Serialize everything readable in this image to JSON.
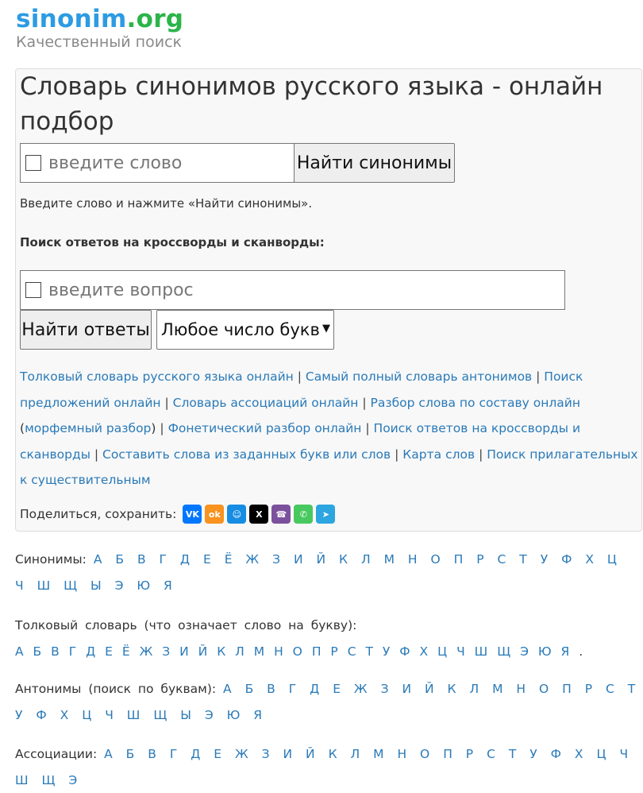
{
  "logo": {
    "name_part1": "sinonim",
    "name_part2": ".org",
    "tagline": "Качественный поиск"
  },
  "main": {
    "title": "Словарь синонимов русского языка - онлайн подбор",
    "word_search": {
      "placeholder": "введите слово",
      "button": "Найти синонимы"
    },
    "hint": "Введите слово и нажмите «Найти синонимы».",
    "crossword_title": "Поиск ответов на кроссворды и сканворды:",
    "question_search": {
      "placeholder": "введите вопрос",
      "button": "Найти ответы",
      "letters_select": "Любое число букв"
    },
    "links": [
      "Толковый словарь русского языка онлайн",
      "Самый полный словарь антонимов",
      "Поиск предложений онлайн",
      "Словарь ассоциаций онлайн",
      "Разбор слова по составу онлайн",
      "морфемный разбор",
      "Фонетический разбор онлайн",
      "Поиск ответов на кроссворды и сканворды",
      "Составить слова из заданных букв или слов",
      "Карта слов",
      "Поиск прилагательных к существительным"
    ],
    "share_label": "Поделиться, сохранить:",
    "share_icons": [
      "vk-icon",
      "odnoklassniki-icon",
      "moimir-icon",
      "x-icon",
      "viber-icon",
      "whatsapp-icon",
      "telegram-icon"
    ]
  },
  "alphabets": {
    "synonyms": {
      "label": "Синонимы:",
      "letters": [
        "А",
        "Б",
        "В",
        "Г",
        "Д",
        "Е",
        "Ё",
        "Ж",
        "З",
        "И",
        "Й",
        "К",
        "Л",
        "М",
        "Н",
        "О",
        "П",
        "Р",
        "С",
        "Т",
        "У",
        "Ф",
        "Х",
        "Ц",
        "Ч",
        "Ш",
        "Щ",
        "Ы",
        "Э",
        "Ю",
        "Я"
      ]
    },
    "explanatory": {
      "label": "Толковый словарь (что означает слово на букву):",
      "letters": [
        "А",
        "Б",
        "В",
        "Г",
        "Д",
        "Е",
        "Ё",
        "Ж",
        "З",
        "И",
        "Й",
        "К",
        "Л",
        "М",
        "Н",
        "О",
        "П",
        "Р",
        "С",
        "Т",
        "У",
        "Ф",
        "Х",
        "Ц",
        "Ч",
        "Ш",
        "Щ",
        "Э",
        "Ю",
        "Я"
      ]
    },
    "antonyms": {
      "label": "Антонимы (поиск по буквам):",
      "letters": [
        "А",
        "Б",
        "В",
        "Г",
        "Д",
        "Е",
        "Ж",
        "З",
        "И",
        "Й",
        "К",
        "Л",
        "М",
        "Н",
        "О",
        "П",
        "Р",
        "С",
        "Т",
        "У",
        "Ф",
        "Х",
        "Ц",
        "Ч",
        "Ш",
        "Щ",
        "Ы",
        "Э",
        "Ю",
        "Я"
      ]
    },
    "associations": {
      "label": "Ассоциации:",
      "letters": [
        "А",
        "Б",
        "В",
        "Г",
        "Д",
        "Е",
        "Ж",
        "З",
        "И",
        "Й",
        "К",
        "Л",
        "М",
        "Н",
        "О",
        "П",
        "Р",
        "С",
        "Т",
        "У",
        "Ф",
        "Х",
        "Ц",
        "Ч",
        "Ш",
        "Щ",
        "Э"
      ]
    }
  },
  "colors": {
    "link": "#2a7ab8",
    "logo_blue": "#2d9be2",
    "logo_green": "#2bb44a",
    "panel_bg": "#f8f8f8"
  }
}
